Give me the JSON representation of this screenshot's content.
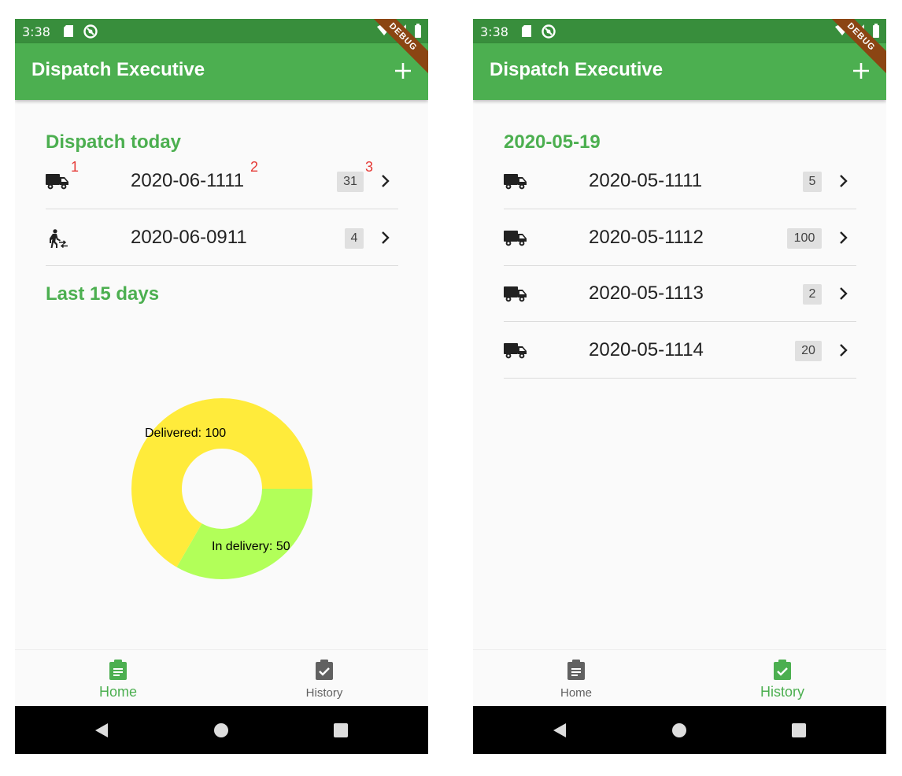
{
  "colors": {
    "status_bar": "#388e3c",
    "app_bar": "#4caf50",
    "accent": "#4caf50",
    "delivered": "#ffeb3b",
    "in_delivery": "#b2ff59",
    "annotation": "#e53935"
  },
  "status": {
    "time": "3:38",
    "debug": "DEBUG"
  },
  "app": {
    "title": "Dispatch Executive"
  },
  "home": {
    "dispatch_today_title": "Dispatch today",
    "rows": [
      {
        "icon": "truck-icon",
        "label": "2020-06-1111",
        "count": "31"
      },
      {
        "icon": "walking-transfer-icon",
        "label": "2020-06-0911",
        "count": "4"
      }
    ],
    "annotations": [
      "1",
      "2",
      "3"
    ],
    "last_days_title": "Last 15 days"
  },
  "chart_data": {
    "type": "pie",
    "categories": [
      "Delivered",
      "In delivery"
    ],
    "values": [
      100,
      50
    ],
    "labels": [
      "Delivered: 100",
      "In delivery: 50"
    ],
    "colors": [
      "#ffeb3b",
      "#b2ff59"
    ]
  },
  "history": {
    "date_title": "2020-05-19",
    "rows": [
      {
        "icon": "truck-icon",
        "label": "2020-05-1111",
        "count": "5"
      },
      {
        "icon": "truck-icon",
        "label": "2020-05-1112",
        "count": "100"
      },
      {
        "icon": "truck-icon",
        "label": "2020-05-1113",
        "count": "2"
      },
      {
        "icon": "truck-icon",
        "label": "2020-05-1114",
        "count": "20"
      }
    ]
  },
  "nav": {
    "home": "Home",
    "history": "History"
  }
}
